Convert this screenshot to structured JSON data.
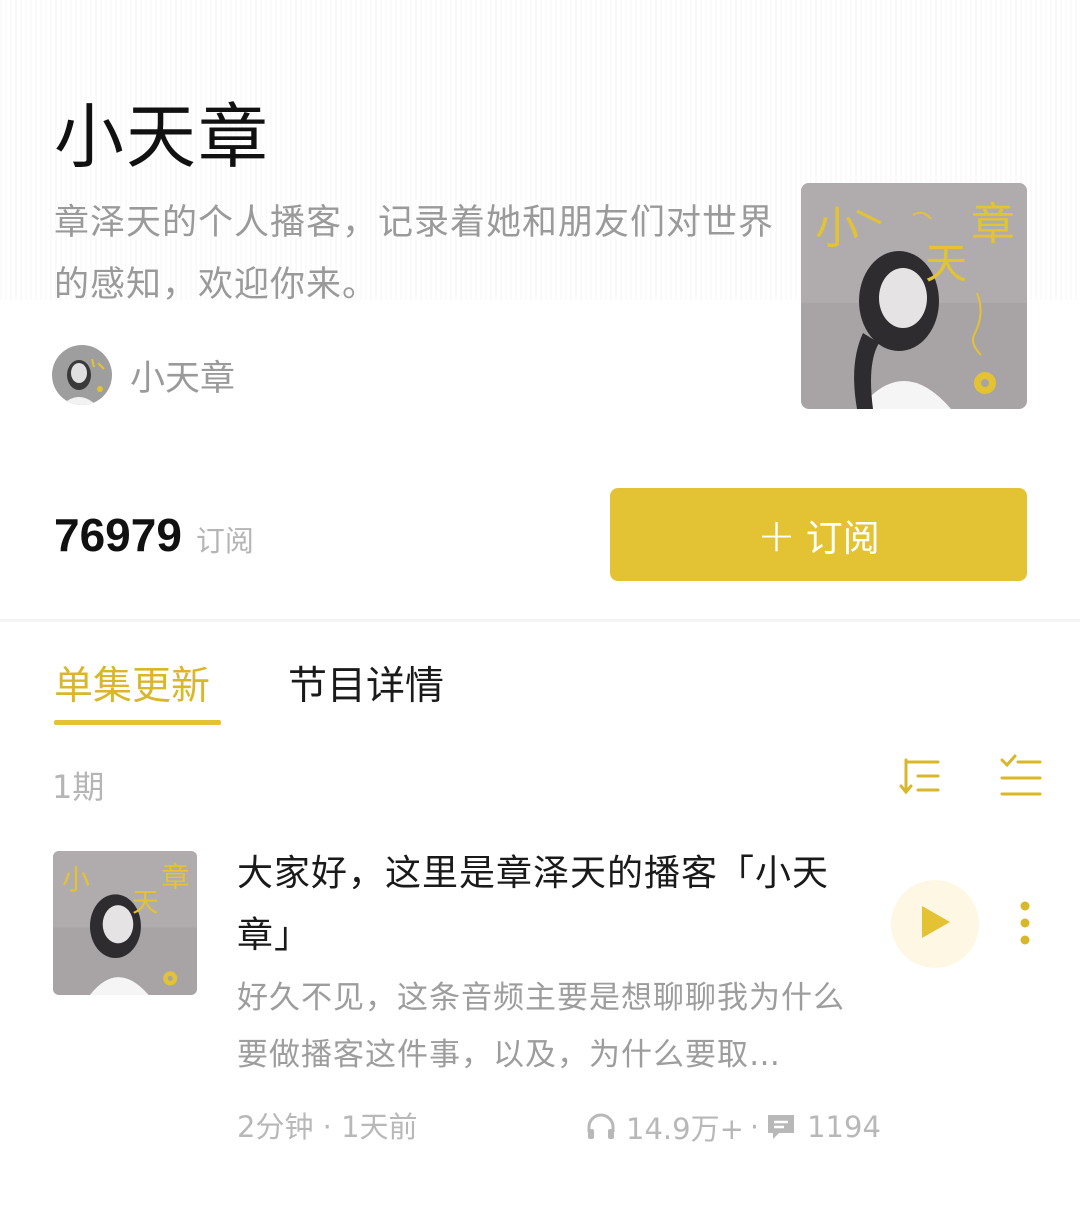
{
  "podcast": {
    "title": "小天章",
    "description": "章泽天的个人播客，记录着她和朋友们对世界的感知，欢迎你来。",
    "author_name": "小天章",
    "cover_text_1": "小",
    "cover_text_2": "天",
    "cover_text_3": "章"
  },
  "subscription": {
    "count": "76979",
    "count_label": "订阅",
    "button_plus": "+",
    "button_label": "订阅"
  },
  "tabs": {
    "episodes": "单集更新",
    "details": "节目详情"
  },
  "episode_list": {
    "count_label": "1期",
    "sort_icon": "sort-order-icon",
    "multiselect_icon": "multi-select-icon"
  },
  "episode": {
    "title": "大家好，这里是章泽天的播客「小天章」",
    "description": "好久不见，这条音频主要是想聊聊我为什么要做播客这件事，以及，为什么要取…",
    "duration_time": "2分钟 · 1天前",
    "plays": "14.9万+",
    "dot": "·",
    "comments": "1194",
    "play_icon": "play-icon",
    "more_icon": "more-vertical-icon"
  },
  "colors": {
    "accent": "#e3c233",
    "accent_text": "#d9b72a",
    "muted_text": "#9a9a9a",
    "play_bg": "#fdf7e4"
  }
}
